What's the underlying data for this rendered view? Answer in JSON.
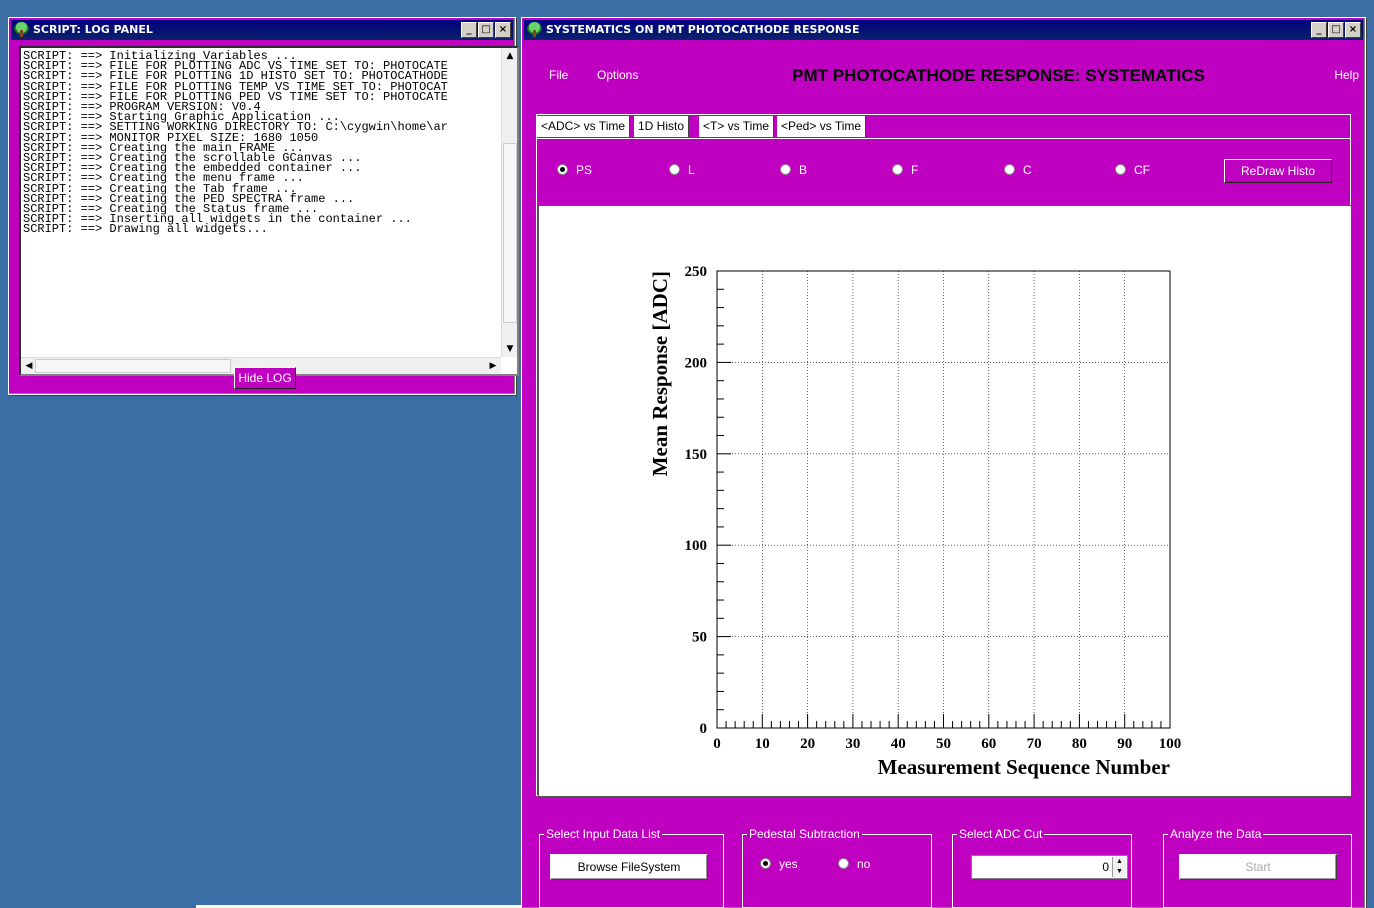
{
  "log_window": {
    "title": "SCRIPT: LOG PANEL",
    "lines": [
      "SCRIPT: ==> Initializing Variables ...",
      "SCRIPT: ==> FILE FOR PLOTTING ADC VS TIME SET TO: PHOTOCATE",
      "SCRIPT: ==> FILE FOR PLOTTING 1D HISTO SET TO: PHOTOCATHODE",
      "SCRIPT: ==> FILE FOR PLOTTING TEMP VS TIME SET TO: PHOTOCAT",
      "SCRIPT: ==> FILE FOR PLOTTING PED VS TIME SET TO: PHOTOCATE",
      "SCRIPT: ==> PROGRAM VERSION: V0.4",
      "SCRIPT: ==> Starting Graphic Application ...",
      "SCRIPT: ==> SETTING WORKING DIRECTORY TO: C:\\cygwin\\home\\ar",
      "SCRIPT: ==> MONITOR PIXEL SIZE: 1680 1050",
      "SCRIPT: ==> Creating the main FRAME ...",
      "SCRIPT: ==> Creating the scrollable GCanvas ...",
      "SCRIPT: ==> Creating the embedded container ...",
      "SCRIPT: ==> Creating the menu frame ...",
      "SCRIPT: ==> Creating the Tab frame ...",
      "SCRIPT: ==> Creating the PED SPECTRA frame ...",
      "SCRIPT: ==> Creating the Status frame ...",
      "SCRIPT: ==> Inserting all widgets in the container ...",
      "SCRIPT: ==> Drawing all widgets..."
    ],
    "hide_button": "Hide LOG"
  },
  "main_window": {
    "title": "SYSTEMATICS ON PMT PHOTOCATHODE RESPONSE",
    "menu": {
      "file": "File",
      "options": "Options",
      "help": "Help"
    },
    "app_title": "PMT PHOTOCATHODE RESPONSE: SYSTEMATICS",
    "tabs": [
      {
        "label": "<ADC> vs Time",
        "active": true
      },
      {
        "label": "1D Histo",
        "active": false
      },
      {
        "label": "<T> vs Time",
        "active": false
      },
      {
        "label": "<Ped> vs Time",
        "active": false
      }
    ],
    "radios": [
      {
        "label": "PS",
        "checked": true
      },
      {
        "label": "L",
        "checked": false
      },
      {
        "label": "B",
        "checked": false
      },
      {
        "label": "F",
        "checked": false
      },
      {
        "label": "C",
        "checked": false
      },
      {
        "label": "CF",
        "checked": false
      }
    ],
    "redraw_button": "ReDraw Histo",
    "groups": {
      "input": {
        "label": "Select Input Data List",
        "button": "Browse FileSystem"
      },
      "pedestal": {
        "label": "Pedestal Subtraction",
        "yes": "yes",
        "no": "no",
        "selected": "yes"
      },
      "adc_cut": {
        "label": "Select ADC Cut",
        "value": "0"
      },
      "analyze": {
        "label": "Analyze the Data",
        "button": "Start"
      }
    }
  },
  "colors": {
    "window_bg": "#c000c0",
    "desktop": "#3a6ea5",
    "titlebar": "#0a246a"
  },
  "chart_data": {
    "type": "scatter",
    "x": [],
    "y": [],
    "xlabel": "Measurement Sequence Number",
    "ylabel": "Mean Response [ADC]",
    "xlim": [
      0,
      100
    ],
    "ylim": [
      0,
      250
    ],
    "xticks": [
      0,
      10,
      20,
      30,
      40,
      50,
      60,
      70,
      80,
      90,
      100
    ],
    "yticks": [
      0,
      50,
      100,
      150,
      200,
      250
    ],
    "grid": true
  }
}
